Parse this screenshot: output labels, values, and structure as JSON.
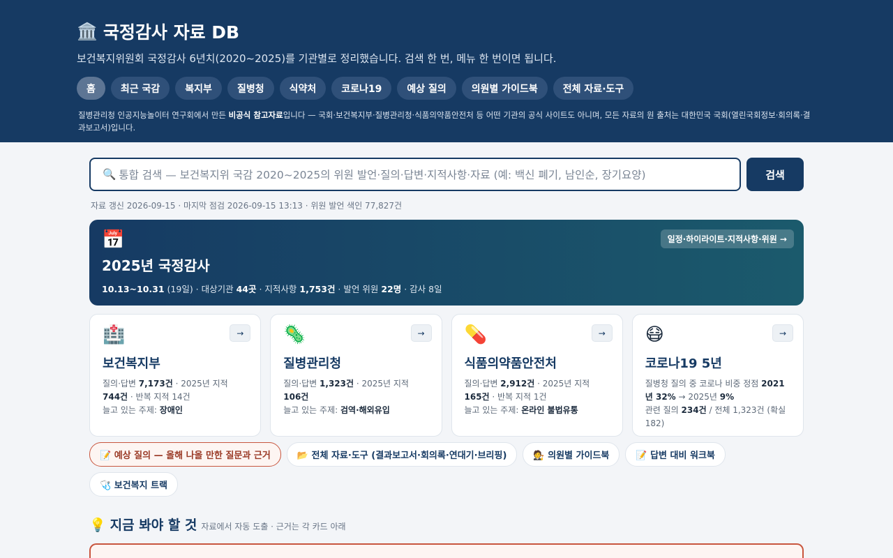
{
  "header": {
    "title_emoji": "🏛️",
    "title": "국정감사 자료 DB",
    "subtitle": "보건복지위원회 국정감사 6년치(2020~2025)를 기관별로 정리했습니다. 검색 한 번, 메뉴 한 번이면 됩니다.",
    "nav": [
      "홈",
      "최근 국감",
      "복지부",
      "질병청",
      "식약처",
      "코로나19",
      "예상 질의",
      "의원별 가이드북",
      "전체 자료·도구"
    ],
    "disclaimer_pre": "질병관리청 인공지능놀이터 연구회에서 만든 ",
    "disclaimer_bold": "비공식 참고자료",
    "disclaimer_post": "입니다 — 국회·보건복지부·질병관리청·식품의약품안전처 등 어떤 기관의 공식 사이트도 아니며, 모든 자료의 원 출처는 대한민국 국회(열린국회정보·회의록·결과보고서)입니다."
  },
  "search": {
    "icon": "🔍",
    "placeholder": "통합 검색 — 보건복지위 국감 2020~2025의 위원 발언·질의·답변·지적사항·자료 (예: 백신 폐기, 남인순, 장기요양)",
    "button": "검색",
    "meta": "자료 갱신 2026-09-15 · 마지막 점검 2026-09-15 13:13 · 위원 발언 색인 77,827건"
  },
  "audit": {
    "icon": "📅",
    "title": "2025년 국정감사",
    "dates": "10.13~10.31",
    "days": " (19일) · 대상기관 ",
    "agencies": "44곳",
    "findings_label": " · 지적사항 ",
    "findings": "1,753건",
    "members_label": " · 발언 위원 ",
    "members": "22명",
    "tail": " · 감사 8일",
    "link": "일정·하이라이트·지적사항·위원 →"
  },
  "cards": [
    {
      "emoji": "🏥",
      "title": "보건복지부",
      "l1a": "질의·답변 ",
      "l1b": "7,173건",
      "l1c": " · 2025년 지적 ",
      "l1d": "744건",
      "l2": " · 반복 지적 14건",
      "l3a": "늘고 있는 주제: ",
      "l3b": "장애인"
    },
    {
      "emoji": "🦠",
      "title": "질병관리청",
      "l1a": "질의·답변 ",
      "l1b": "1,323건",
      "l1c": " · 2025년 지적 ",
      "l1d": "106건",
      "l2": "",
      "l3a": "늘고 있는 주제: ",
      "l3b": "검역·해외유입"
    },
    {
      "emoji": "💊",
      "title": "식품의약품안전처",
      "l1a": "질의·답변 ",
      "l1b": "2,912건",
      "l1c": " · 2025년 지적 ",
      "l1d": "165건",
      "l2": " · 반복 지적 1건",
      "l3a": "늘고 있는 주제: ",
      "l3b": "온라인 불법유통"
    },
    {
      "emoji": "😷",
      "title": "코로나19 5년",
      "l1a": "질병청 질의 중 코로나 비중 정점 ",
      "l1b": "2021년 32%",
      "l1c": " → 2025년 ",
      "l1d": "9%",
      "l2": "",
      "l3a": "관련 질의 ",
      "l3b": "234건",
      "l3c": " / 전체 1,323건 (확실 182)"
    }
  ],
  "arrow": "→",
  "chips": [
    {
      "label": "📝 예상 질의 — 올해 나올 만한 질문과 근거",
      "hot": true
    },
    {
      "label": "📂 전체 자료·도구 (결과보고서·회의록·연대기·브리핑)",
      "hot": false
    },
    {
      "label": "🧑‍⚖️ 의원별 가이드북",
      "hot": false
    },
    {
      "label": "📝 답변 대비 워크북",
      "hot": false
    },
    {
      "label": "🩺 보건복지 트랙",
      "hot": false
    }
  ],
  "now": {
    "icon": "💡",
    "title": "지금 봐야 할 것",
    "sub": "자료에서 자동 도출 · 근거는 각 카드 아래"
  }
}
